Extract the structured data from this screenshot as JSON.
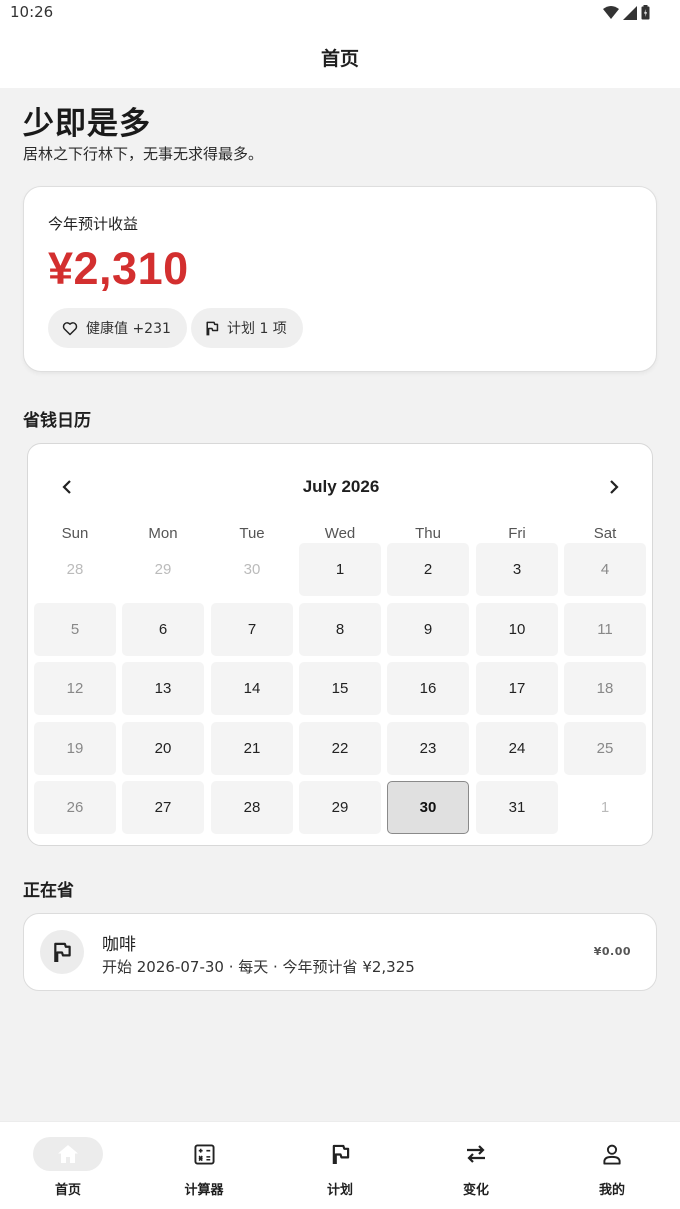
{
  "status": {
    "time": "10:26"
  },
  "appbar": {
    "title": "首页"
  },
  "hero": {
    "title": "少即是多",
    "subtitle": "居林之下行林下，无事无求得最多。"
  },
  "summary": {
    "label": "今年预计收益",
    "value": "¥2,310",
    "value_color": "#d32f2f",
    "chips": [
      {
        "icon": "heart-icon",
        "label": "健康值 +231"
      },
      {
        "icon": "flag-icon",
        "label": "计划 1 项"
      }
    ]
  },
  "calendar": {
    "section_title": "省钱日历",
    "month": "July 2026",
    "weekdays": [
      "Sun",
      "Mon",
      "Tue",
      "Wed",
      "Thu",
      "Fri",
      "Sat"
    ],
    "weeks": [
      [
        "28",
        "29",
        "30",
        "1",
        "2",
        "3",
        "4"
      ],
      [
        "5",
        "6",
        "7",
        "8",
        "9",
        "10",
        "11"
      ],
      [
        "12",
        "13",
        "14",
        "15",
        "16",
        "17",
        "18"
      ],
      [
        "19",
        "20",
        "21",
        "22",
        "23",
        "24",
        "25"
      ],
      [
        "26",
        "27",
        "28",
        "29",
        "30",
        "31",
        "1"
      ]
    ],
    "selected_day": "30"
  },
  "saving": {
    "section_title": "正在省",
    "items": [
      {
        "icon": "flag-icon",
        "name": "咖啡",
        "meta": "开始 2026-07-30 · 每天 · 今年预计省 ¥2,325",
        "amount": "¥0.00"
      }
    ]
  },
  "nav": {
    "items": [
      {
        "icon": "home-icon",
        "label": "首页",
        "active": true
      },
      {
        "icon": "calculator-icon",
        "label": "计算器",
        "active": false
      },
      {
        "icon": "flag-icon",
        "label": "计划",
        "active": false
      },
      {
        "icon": "swap-icon",
        "label": "变化",
        "active": false
      },
      {
        "icon": "person-icon",
        "label": "我的",
        "active": false
      }
    ]
  }
}
